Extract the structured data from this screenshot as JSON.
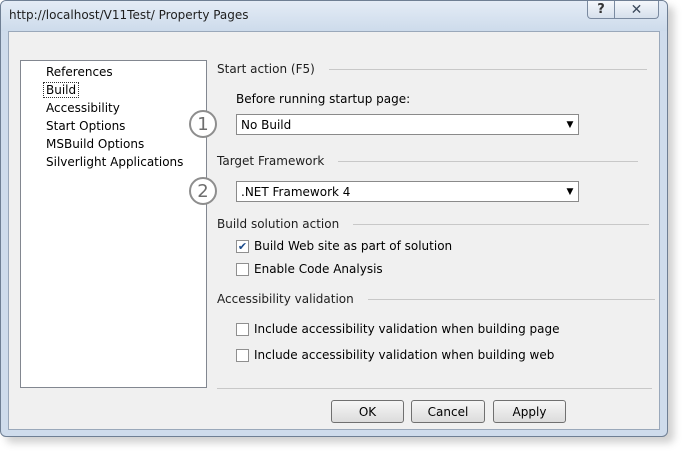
{
  "window": {
    "title": "http://localhost/V11Test/ Property Pages",
    "help_label": "?",
    "close_label": "✕"
  },
  "nav": {
    "items": [
      {
        "label": "References",
        "selected": false
      },
      {
        "label": "Build",
        "selected": true
      },
      {
        "label": "Accessibility",
        "selected": false
      },
      {
        "label": "Start Options",
        "selected": false
      },
      {
        "label": "MSBuild Options",
        "selected": false
      },
      {
        "label": "Silverlight Applications",
        "selected": false
      }
    ]
  },
  "start_action": {
    "heading": "Start action (F5)",
    "before_label": "Before running startup page:",
    "callout": "1",
    "selected": "No Build"
  },
  "target_framework": {
    "heading": "Target Framework",
    "callout": "2",
    "selected": ".NET Framework 4"
  },
  "build_solution": {
    "heading": "Build solution action",
    "options": [
      {
        "label": "Build Web site as part of solution",
        "checked": true
      },
      {
        "label": "Enable Code Analysis",
        "checked": false
      }
    ]
  },
  "accessibility_validation": {
    "heading": "Accessibility validation",
    "options": [
      {
        "label": "Include accessibility validation when building page",
        "checked": false
      },
      {
        "label": "Include accessibility validation when building web",
        "checked": false
      }
    ]
  },
  "buttons": {
    "ok": "OK",
    "cancel": "Cancel",
    "apply": "Apply"
  },
  "colors": {
    "frame": "#cfdcec",
    "client": "#f0f0f0",
    "check_mark": "#1a4a8a"
  }
}
